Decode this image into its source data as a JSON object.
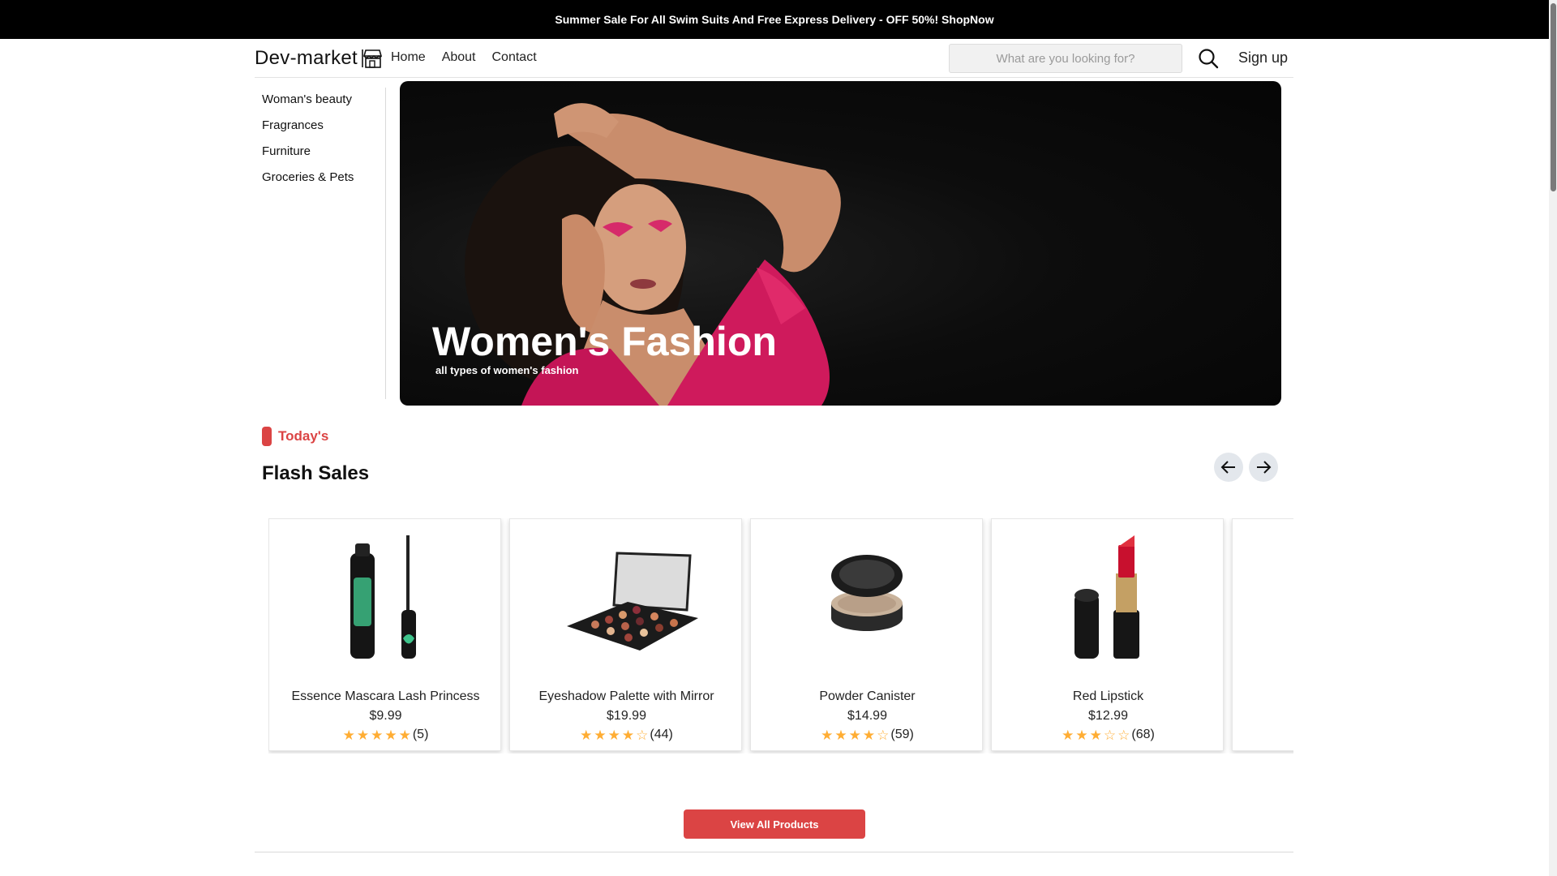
{
  "banner": {
    "text": "Summer Sale For All Swim Suits And Free Express Delivery - OFF 50%! ShopNow"
  },
  "header": {
    "logo": "Dev-market",
    "nav": [
      "Home",
      "About",
      "Contact"
    ],
    "search_placeholder": "What are you looking for?",
    "signup": "Sign up"
  },
  "sidebar": {
    "categories": [
      "Woman's beauty",
      "Fragrances",
      "Furniture",
      "Groceries & Pets"
    ]
  },
  "hero": {
    "title": "Women's Fashion",
    "subtitle": "all types of women's fashion"
  },
  "section": {
    "tag": "Today's",
    "title": "Flash Sales"
  },
  "products": [
    {
      "name": "Essence Mascara Lash Princess",
      "price": "$9.99",
      "rating": 5,
      "reviews": "(5)",
      "icon": "mascara-icon"
    },
    {
      "name": "Eyeshadow Palette with Mirror",
      "price": "$19.99",
      "rating": 4,
      "reviews": "(44)",
      "icon": "eyeshadow-palette-icon"
    },
    {
      "name": "Powder Canister",
      "price": "$14.99",
      "rating": 4,
      "reviews": "(59)",
      "icon": "powder-canister-icon"
    },
    {
      "name": "Red Lipstick",
      "price": "$12.99",
      "rating": 3,
      "reviews": "(68)",
      "icon": "lipstick-icon"
    }
  ],
  "view_all": "View All Products",
  "colors": {
    "accent": "#db4444",
    "star": "#ffad33",
    "banner": "#000000"
  }
}
